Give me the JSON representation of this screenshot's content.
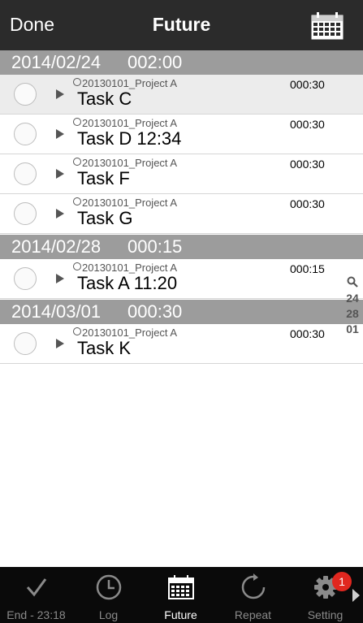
{
  "header": {
    "done_label": "Done",
    "title": "Future"
  },
  "sections": [
    {
      "date": "2014/02/24",
      "duration": "002:00",
      "tasks": [
        {
          "project": "20130101_Project A",
          "name": "Task C",
          "time": "000:30"
        },
        {
          "project": "20130101_Project A",
          "name": "Task D 12:34",
          "time": "000:30"
        },
        {
          "project": "20130101_Project A",
          "name": "Task F",
          "time": "000:30"
        },
        {
          "project": "20130101_Project A",
          "name": "Task G",
          "time": "000:30"
        }
      ]
    },
    {
      "date": "2014/02/28",
      "duration": "000:15",
      "tasks": [
        {
          "project": "20130101_Project A",
          "name": "Task A 11:20",
          "time": "000:15"
        }
      ]
    },
    {
      "date": "2014/03/01",
      "duration": "000:30",
      "tasks": [
        {
          "project": "20130101_Project A",
          "name": "Task K",
          "time": "000:30"
        }
      ]
    }
  ],
  "index": [
    "24",
    "28",
    "01"
  ],
  "tabs": [
    {
      "label": "End - 23:18",
      "icon": "checkmark-icon"
    },
    {
      "label": "Log",
      "icon": "clock-icon"
    },
    {
      "label": "Future",
      "icon": "calendar-icon",
      "active": true
    },
    {
      "label": "Repeat",
      "icon": "repeat-icon"
    },
    {
      "label": "Setting",
      "icon": "gear-icon"
    }
  ],
  "settings_badge": "1",
  "colors": {
    "navbar": "#2b2b2b",
    "section_header": "#9c9c9c",
    "tabbar": "#0a0a0a",
    "badge": "#e0271f",
    "selected_row": "#ececec"
  }
}
